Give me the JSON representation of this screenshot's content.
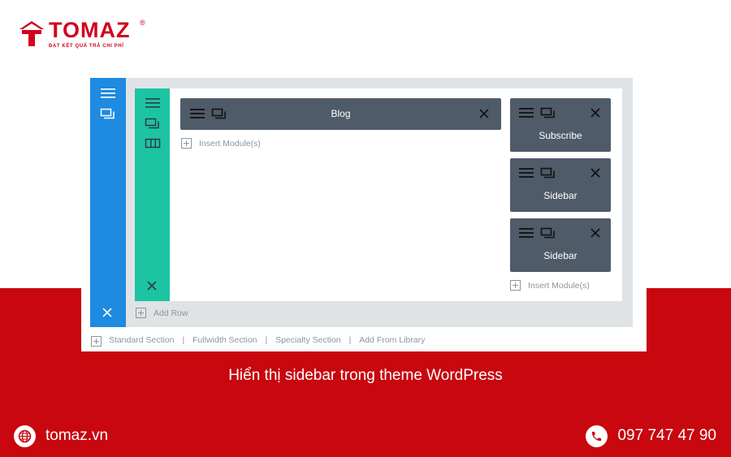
{
  "brand": {
    "name": "TOMAZ",
    "registered": "®",
    "tagline": "ĐẠT KẾT QUẢ TRẢ CHI PHÍ",
    "accent_color": "#c8070f"
  },
  "builder": {
    "modules": {
      "blog": "Blog",
      "subscribe": "Subscribe",
      "sidebar_1": "Sidebar",
      "sidebar_2": "Sidebar"
    },
    "insert_module_label": "Insert Module(s)",
    "add_row_label": "Add Row",
    "links": {
      "standard": "Standard Section",
      "fullwidth": "Fullwidth Section",
      "specialty": "Specialty Section",
      "library": "Add From Library",
      "separator": "|"
    },
    "colors": {
      "section_bar": "#1e8ae0",
      "row_bar": "#1cc4a4",
      "module_bg": "#4f5b69"
    },
    "icons": [
      "hamburger-icon",
      "duplicate-icon",
      "columns-icon",
      "close-icon",
      "plus-icon"
    ]
  },
  "caption": "Hiển thị sidebar trong theme WordPress",
  "footer": {
    "website": "tomaz.vn",
    "phone": "097 747 47 90",
    "icons": [
      "globe-icon",
      "phone-icon"
    ]
  }
}
